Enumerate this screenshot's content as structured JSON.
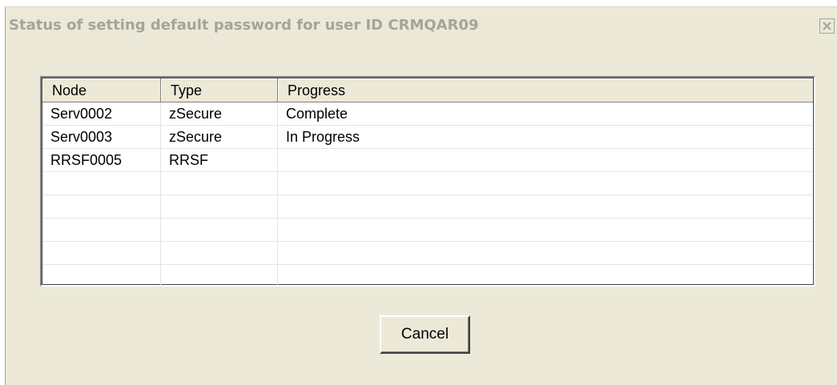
{
  "dialog": {
    "title": "Status of setting default password for user ID CRMQAR09",
    "close_icon": "close-icon"
  },
  "table": {
    "columns": [
      "Node",
      "Type",
      "Progress"
    ],
    "rows": [
      {
        "node": "Serv0002",
        "type": "zSecure",
        "progress": "Complete"
      },
      {
        "node": "Serv0003",
        "type": "zSecure",
        "progress": "In Progress"
      },
      {
        "node": "RRSF0005",
        "type": "RRSF",
        "progress": ""
      }
    ]
  },
  "buttons": {
    "cancel_label": "Cancel"
  },
  "colors": {
    "dialog_background": "#ece9d8",
    "title_text": "#a6a49a",
    "list_background": "#ffffff"
  }
}
